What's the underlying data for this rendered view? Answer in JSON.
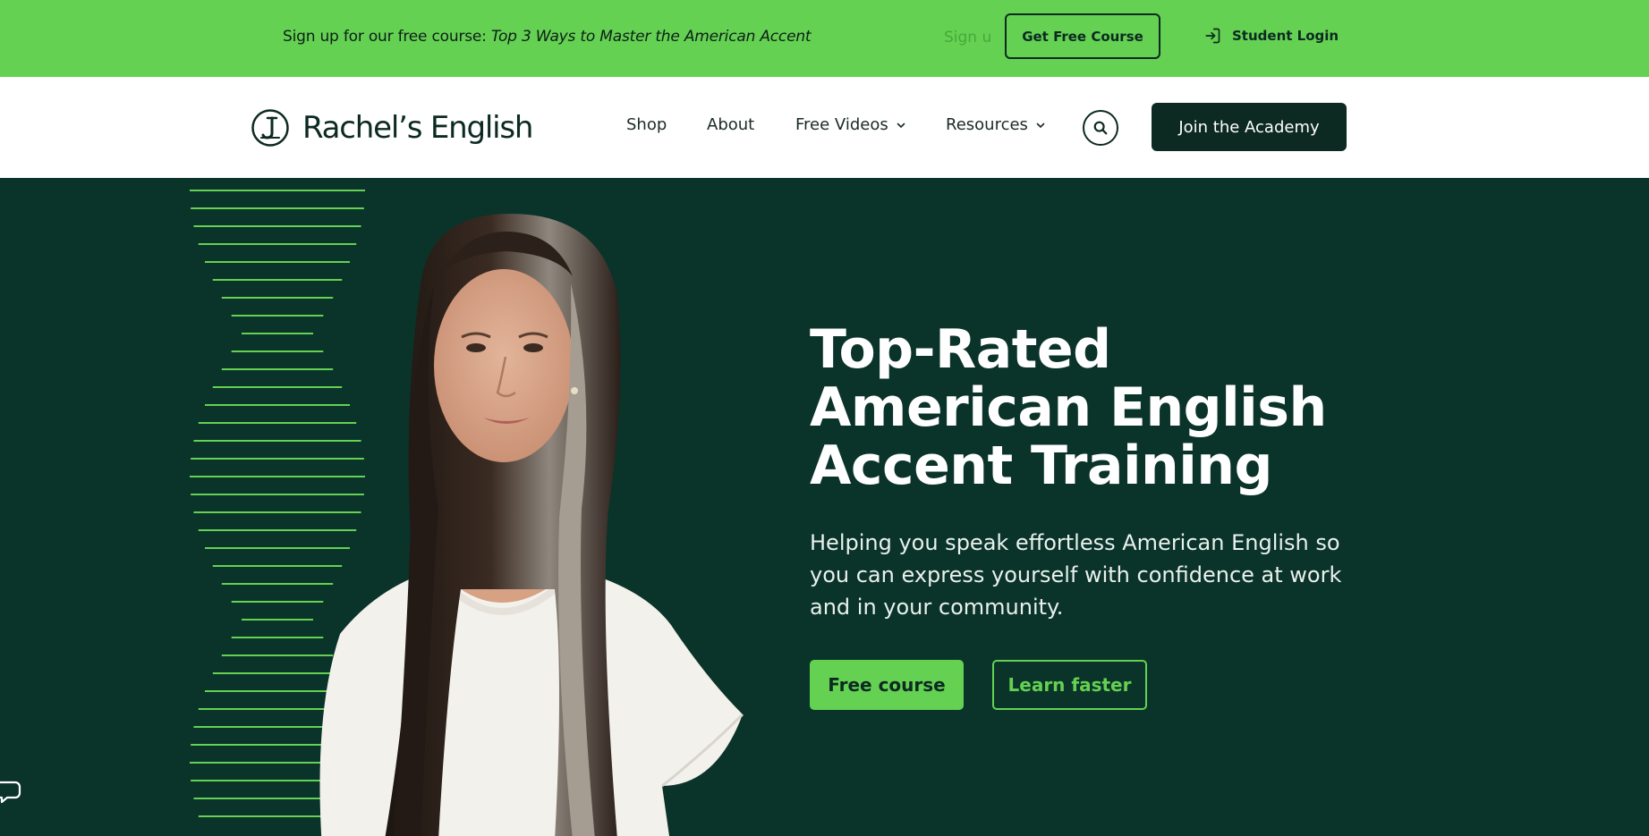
{
  "colors": {
    "brand_green": "#64d152",
    "dark_green": "#0c2a22",
    "hero_bg": "#0a3329",
    "white": "#ffffff"
  },
  "promo": {
    "lead": "Sign up for our free course: ",
    "course_title": "Top 3 Ways to Master the American Accent",
    "ghost_signup": "Sign up",
    "cta_label": "Get Free Course",
    "login_icon": "login-arrow-icon",
    "login_label": "Student Login"
  },
  "header": {
    "logo_icon": "rachels-english-logo-icon",
    "logo_text": "Rachel’s English",
    "nav": [
      {
        "label": "Shop",
        "has_dropdown": false
      },
      {
        "label": "About",
        "has_dropdown": false
      },
      {
        "label": "Free Videos",
        "has_dropdown": true
      },
      {
        "label": "Resources",
        "has_dropdown": true
      }
    ],
    "search_icon": "search-icon",
    "join_label": "Join the Academy"
  },
  "hero": {
    "title": "Top-Rated American English Accent Training",
    "subtitle": "Helping you speak effortless American English so you can express yourself with confidence at work and in your community.",
    "primary_cta": "Free course",
    "secondary_cta": "Learn faster",
    "chat_icon": "chat-bubble-icon"
  }
}
